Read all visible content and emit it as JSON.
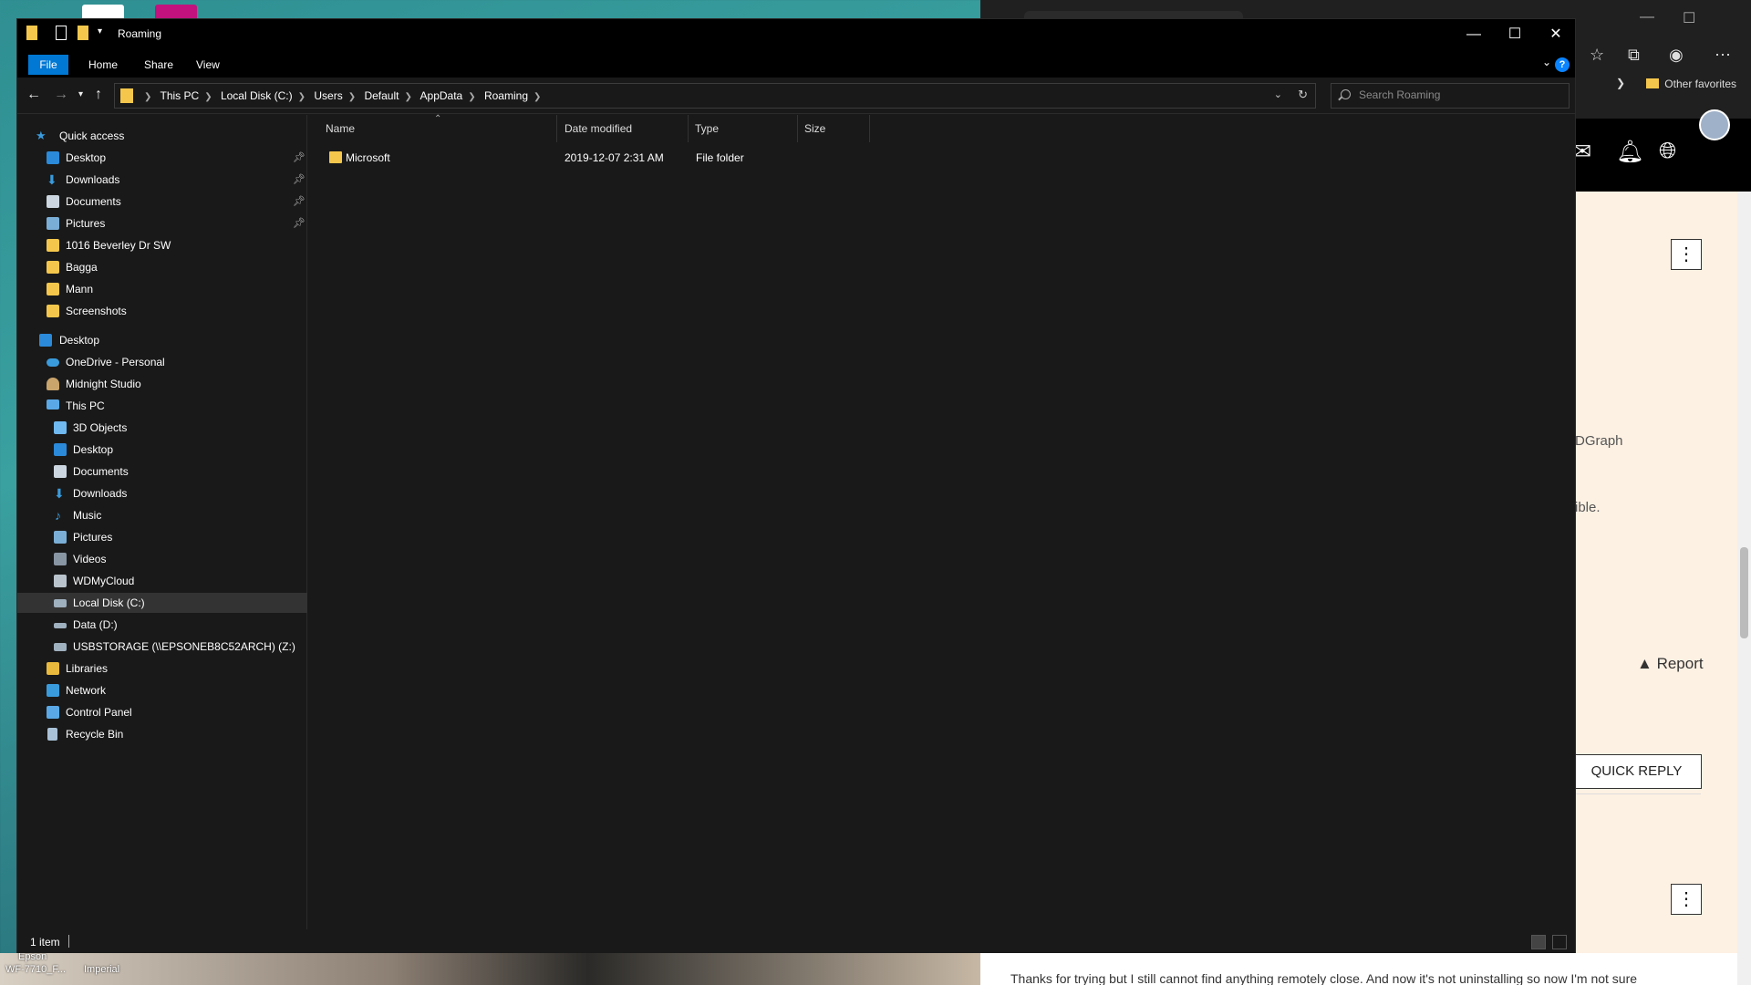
{
  "window": {
    "title": "Roaming",
    "minimize_glyph": "—",
    "maximize_glyph": "☐",
    "close_glyph": "✕"
  },
  "ribbon": {
    "tabs": [
      "File",
      "Home",
      "Share",
      "View"
    ],
    "help_glyph": "?"
  },
  "address": {
    "crumbs": [
      "This PC",
      "Local Disk (C:)",
      "Users",
      "Default",
      "AppData",
      "Roaming"
    ]
  },
  "search": {
    "placeholder": "Search Roaming"
  },
  "nav": {
    "quick_access": "Quick access",
    "quick_items": [
      "Desktop",
      "Downloads",
      "Documents",
      "Pictures",
      "1016 Beverley Dr SW",
      "Bagga",
      "Mann",
      "Screenshots"
    ],
    "desktop": "Desktop",
    "onedrive": "OneDrive - Personal",
    "midnight": "Midnight Studio",
    "this_pc": "This PC",
    "pc_items": [
      "3D Objects",
      "Desktop",
      "Documents",
      "Downloads",
      "Music",
      "Pictures",
      "Videos",
      "WDMyCloud",
      "Local Disk (C:)",
      "Data (D:)",
      "USBSTORAGE (\\\\EPSONEB8C52ARCH) (Z:)"
    ],
    "libraries": "Libraries",
    "network": "Network",
    "control_panel": "Control Panel",
    "recycle_bin": "Recycle Bin"
  },
  "columns": {
    "name": "Name",
    "date": "Date modified",
    "type": "Type",
    "size": "Size"
  },
  "files": [
    {
      "name": "Microsoft",
      "date": "2019-12-07 2:31 AM",
      "type": "File folder",
      "size": ""
    }
  ],
  "status": {
    "count": "1 item"
  },
  "browser": {
    "other_favorites": "Other favorites",
    "snippet_1": "DGraph",
    "snippet_2": "ible.",
    "report": "Report",
    "quick_reply": "QUICK REPLY",
    "bottom_text": "Thanks for trying but I still cannot find anything remotely close. And now it's not uninstalling so now I'm not sure"
  },
  "desktop_labels": [
    "Epson",
    "WF-7710_F...",
    "Imperial"
  ],
  "colors": {
    "accent": "#0078d4",
    "folder": "#f4c74c",
    "window_bg": "#191919"
  }
}
